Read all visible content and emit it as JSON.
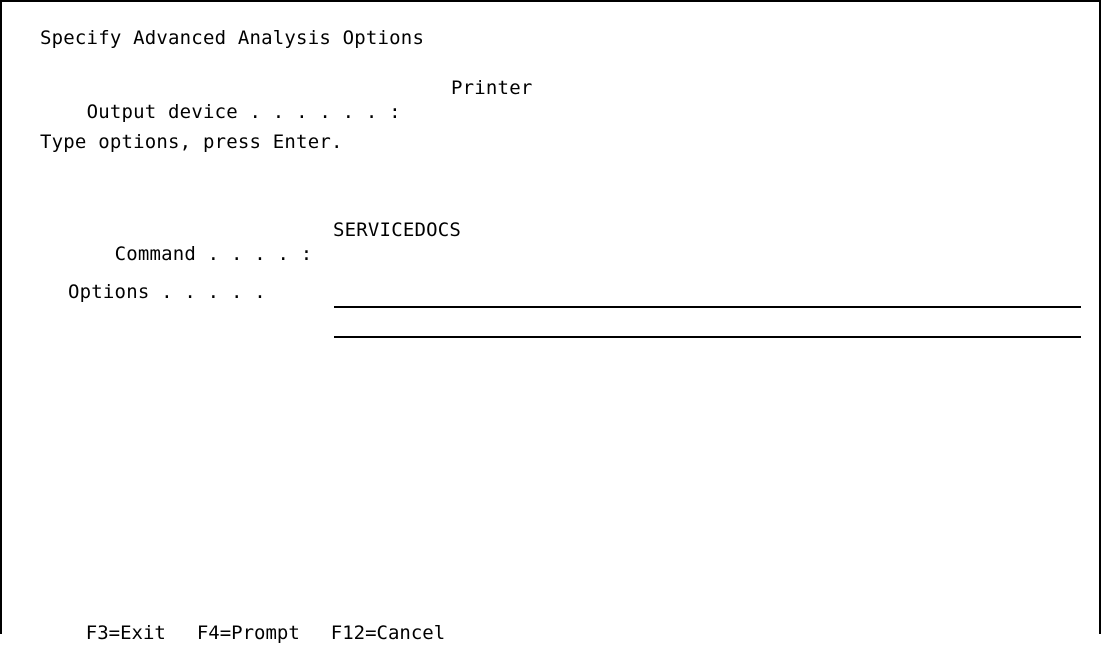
{
  "screen": {
    "title": "Specify Advanced Analysis Options",
    "output_device_label": "Output device . . . . . . :",
    "output_device_value": "Printer",
    "instructions": "Type options, press Enter.",
    "command_label": "Command . . . . :",
    "command_value": "SERVICEDOCS",
    "options_label": "Options . . . . .",
    "options_value": ""
  },
  "function_keys": [
    {
      "label": "F3=Exit"
    },
    {
      "label": "F4=Prompt"
    },
    {
      "label": "F12=Cancel"
    }
  ]
}
